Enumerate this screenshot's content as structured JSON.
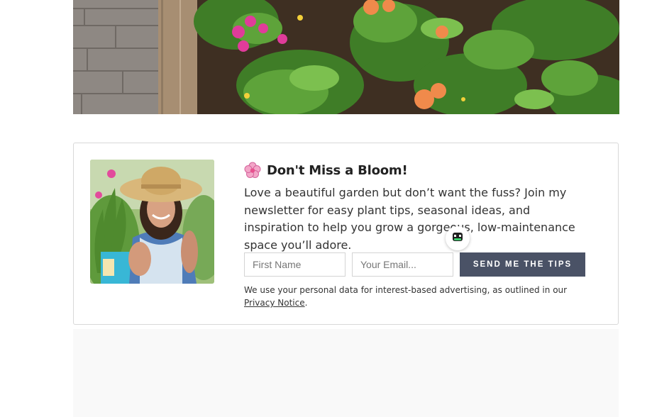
{
  "newsletter": {
    "headline_emoji": "flower-emoji",
    "headline": "Don't Miss a Bloom!",
    "body": "Love a beautiful garden but don’t want the fuss? Join my newsletter for easy plant tips, seasonal ideas, and inspiration to help you grow a gorgeous, low-maintenance space you’ll adore.",
    "first_name_placeholder": "First Name",
    "email_placeholder": "Your Email...",
    "submit_label": "SEND ME THE TIPS",
    "disclaimer_prefix": "We use your personal data for interest-based advertising, as outlined in our",
    "privacy_link": "Privacy Notice",
    "disclaimer_suffix": "."
  },
  "images": {
    "hero": "garden-photo",
    "portrait": "gardener-portrait"
  },
  "icons": {
    "chat": "chat-widget-icon"
  },
  "colors": {
    "button_bg": "#4a5266",
    "button_text": "#ffffff",
    "card_border": "#d8d8d8",
    "text": "#333333",
    "footer_panel": "#f9f9f9"
  }
}
